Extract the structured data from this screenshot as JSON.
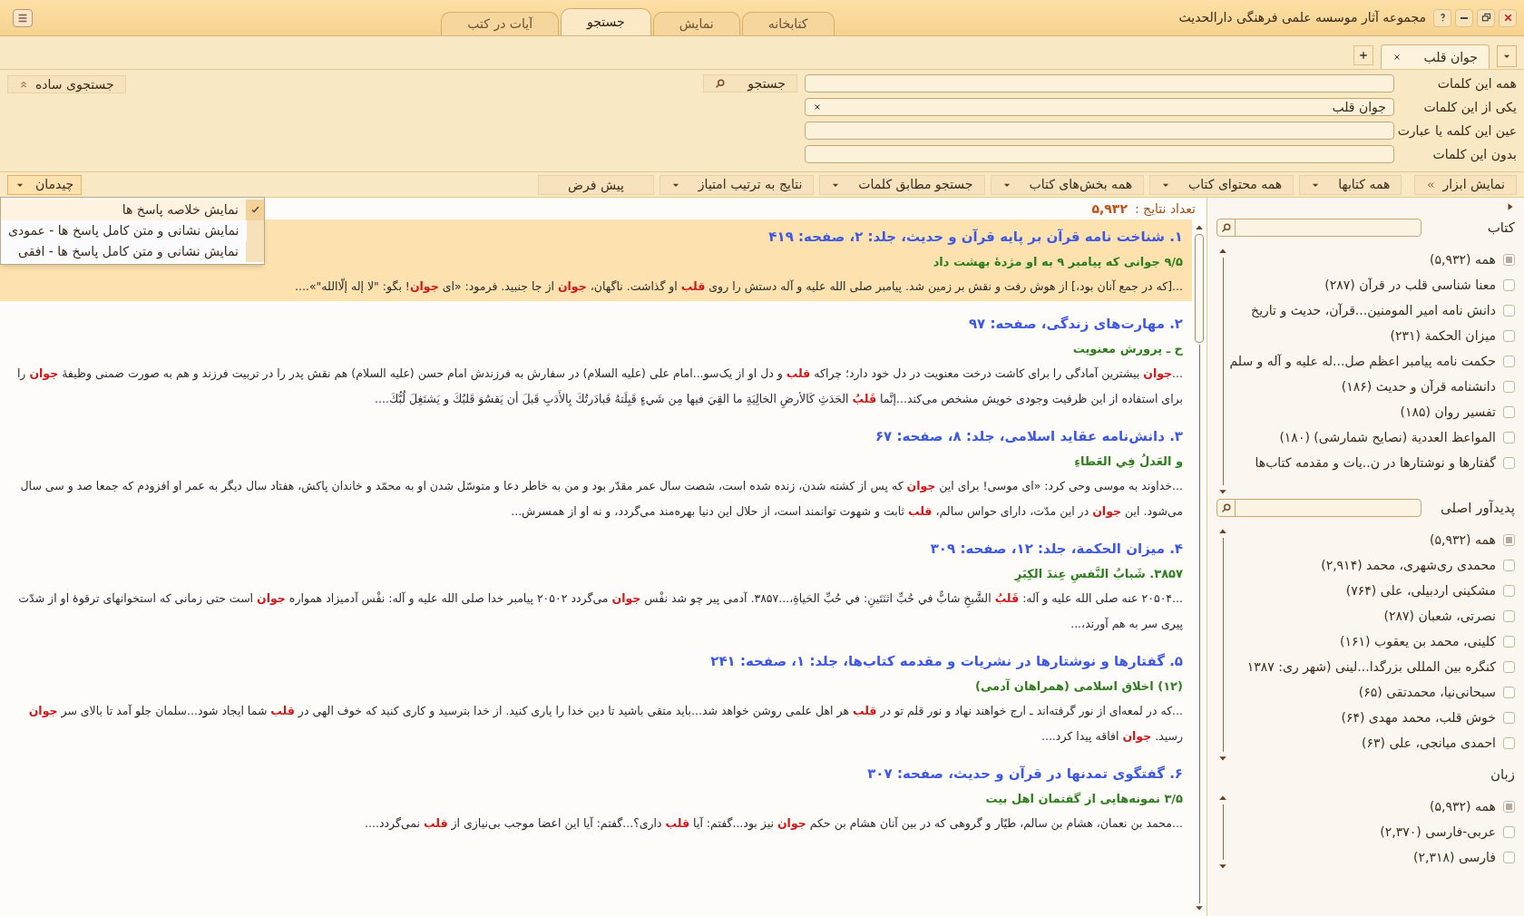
{
  "window": {
    "title": "مجموعه آثار موسسه علمی فرهنگی دارالحدیث"
  },
  "main_tabs": [
    {
      "label": "کتابخانه",
      "selected": false
    },
    {
      "label": "نمایش",
      "selected": false
    },
    {
      "label": "جستجو",
      "selected": true
    },
    {
      "label": "آیات در کتب",
      "selected": false
    }
  ],
  "search_tabs": [
    {
      "label": "جوان قلب",
      "selected": true
    }
  ],
  "search_form": {
    "rows": [
      {
        "label": "همه این کلمات",
        "value": ""
      },
      {
        "label": "یکی از این کلمات",
        "value": "جوان قلب"
      },
      {
        "label": "عین این کلمه یا عبارت",
        "value": ""
      },
      {
        "label": "بدون این کلمات",
        "value": ""
      }
    ],
    "search_button": "جستجو",
    "simple_search_button": "جستجوی ساده"
  },
  "toolbar": {
    "show_tools": "نمایش ابزار",
    "dropdowns": [
      {
        "label": "همه کتابها"
      },
      {
        "label": "همه محتوای کتاب"
      },
      {
        "label": "همه بخش‌های کتاب"
      },
      {
        "label": "جستجو مطابق کلمات"
      },
      {
        "label": "نتایج به ترتیب امتیاز"
      }
    ],
    "default_button": "پیش فرض",
    "layout_button": "چیدمان"
  },
  "layout_menu": {
    "expanded": true,
    "items": [
      {
        "label": "نمایش خلاصه پاسخ ها",
        "selected": true
      },
      {
        "label": "نمایش نشانی و متن کامل پاسخ ها - عمودی",
        "selected": false
      },
      {
        "label": "نمایش نشانی و متن کامل پاسخ ها - افقی",
        "selected": false
      }
    ]
  },
  "results": {
    "count_label": "تعداد نتایج :",
    "count": "۵,۹۳۲",
    "items": [
      {
        "selected": true,
        "title": "۱. شناخت نامه قرآن بر پایه قرآن و حدیث، جلد: ۲، صفحه: ۴۱۹",
        "subtitle": "۹/۵ جوانی که پیامبر ۹ به او مژدهٔ بهشت داد",
        "snippet": [
          {
            "text": "...[که در جمع آنان بود،] از هوش رفت و نقش بر زمین شد. پیامبر صلی الله علیه و آله دستش را روی ",
            "hit": false
          },
          {
            "text": "قلب",
            "hit": true
          },
          {
            "text": " او گذاشت. ناگهان، ",
            "hit": false
          },
          {
            "text": "جوان",
            "hit": true
          },
          {
            "text": " از جا جنبید. فرمود: «ای ",
            "hit": false
          },
          {
            "text": "جوان",
            "hit": true
          },
          {
            "text": "! بگو: \"لا إله إلّاالله\"»....",
            "hit": false
          }
        ]
      },
      {
        "selected": false,
        "title": "۲. مهارت‌های زندگی، صفحه: ۹۷",
        "subtitle": "ح ـ پرورش معنویت",
        "snippet": [
          {
            "text": "...",
            "hit": false
          },
          {
            "text": "جوان",
            "hit": true
          },
          {
            "text": " بیشترین آمادگی را برای کاشت درخت معنویت در دل خود دارد؛ چراکه ",
            "hit": false
          },
          {
            "text": "قلب",
            "hit": true
          },
          {
            "text": " و دل او از یک‌سو...امام علی (علیه السلام) در سفارش به فرزندش امام حسن (علیه السلام) هم نقش پدر را در تربیت فرزند و هم به صورت ضمنی وظیفهٔ ",
            "hit": false
          },
          {
            "text": "جوان",
            "hit": true
          },
          {
            "text": " را برای استفاده از این ظرفیت وجودی خویش مشخص می‌کند...إنَّما ",
            "hit": false
          },
          {
            "text": "قَلبُ",
            "hit": true
          },
          {
            "text": " الحَدَثِ كَالأرضِ الخالِيَةِ ما القِيَ فيها مِن شَيءٍ قَبِلَتهُ فَبادَرتُكَ بِالأَدَبِ قَبلَ أن يَقسُوَ قَلبُكَ و يَشتَغِلَ لُبُّكَ....",
            "hit": false
          }
        ]
      },
      {
        "selected": false,
        "title": "۳. دانش‌نامه عقاید اسلامی، جلد: ۸، صفحه: ۶۷",
        "subtitle": "و العَدلُ فِي العَطاءِ",
        "snippet": [
          {
            "text": "...خداوند به موسی وحی کرد: «ای موسی! برای این ",
            "hit": false
          },
          {
            "text": "جوان",
            "hit": true
          },
          {
            "text": " که پس از کشته شدن، زنده شده است، شصت سال عمر مقدّر بود و من به خاطر دعا و متوسّل شدن او به محمّد و خاندان پاکش، هفتاد سال دیگر به عمر او افزودم که جمعا صد و سی سال می‌شود. این ",
            "hit": false
          },
          {
            "text": "جوان",
            "hit": true
          },
          {
            "text": " در این مدّت، دارای حواس سالم، ",
            "hit": false
          },
          {
            "text": "قلب",
            "hit": true
          },
          {
            "text": " ثابت و شهوت توانمند است، از حلال این دنیا بهره‌مند می‌گردد، و نه او از همسرش...",
            "hit": false
          }
        ]
      },
      {
        "selected": false,
        "title": "۴. ميزان الحكمة، جلد: ۱۲، صفحه: ۳۰۹",
        "subtitle": "۳۸۵۷. شَبابُ النَّفسِ عِندَ الكِبَرِ",
        "snippet": [
          {
            "text": "...۲۰۵۰۴ عنه صلى الله عليه و آله: ",
            "hit": false
          },
          {
            "text": "قَلبُ",
            "hit": true
          },
          {
            "text": " الشَّيخِ شابٌّ في حُبِّ اثنَتَينِ: في حُبِّ الحَياةِ،...۳۸۵۷. آدمی پیر چو شد نفْس ",
            "hit": false
          },
          {
            "text": "جوان",
            "hit": true
          },
          {
            "text": " می‌گردد ۲۰۵۰۲ پیامبر خدا صلی الله علیه و آله: نفْس آدمیزاد همواره ",
            "hit": false
          },
          {
            "text": "جوان",
            "hit": true
          },
          {
            "text": " است حتی زمانی که استخوانهای ترقوهٔ او از شدّت پیری سر به هم آورند،...",
            "hit": false
          }
        ]
      },
      {
        "selected": false,
        "title": "۵. گفتارها و نوشتارها در نشریات و مقدمه کتاب‌ها، جلد: ۱، صفحه: ۲۴۱",
        "subtitle": "(۱۲) اخلاق اسلامی (همراهان آدمی)",
        "snippet": [
          {
            "text": "...که در لمعه‌ای از نور گرفته‌اند ـ ارج خواهند نهاد و نور قلم تو در ",
            "hit": false
          },
          {
            "text": "قلب",
            "hit": true
          },
          {
            "text": " هر اهل علمی روشن خواهد شد...باید متقی باشید تا دین خدا را یاری کنید. از خدا بترسید و کاری کنید که خوف الهی در ",
            "hit": false
          },
          {
            "text": "قلب",
            "hit": true
          },
          {
            "text": " شما ایجاد شود...سلمان جلو آمد تا بالای سر ",
            "hit": false
          },
          {
            "text": "جوان",
            "hit": true
          },
          {
            "text": " رسید. ",
            "hit": false
          },
          {
            "text": "جوان",
            "hit": true
          },
          {
            "text": " افاقه پیدا کرد....",
            "hit": false
          }
        ]
      },
      {
        "selected": false,
        "title": "۶. گفتگوی تمدنها در قرآن و حدیث، صفحه: ۳۰۷",
        "subtitle": "۳/۵ نمونه‌هایی از گفتمان اهل بیت",
        "snippet": [
          {
            "text": "...محمد بن نعمان، هشام بن سالم، طیّار و گروهی که در بین آنان هشام بن حکم ",
            "hit": false
          },
          {
            "text": "جوان",
            "hit": true
          },
          {
            "text": " نیز بود...گفتم: آیا ",
            "hit": false
          },
          {
            "text": "قلب",
            "hit": true
          },
          {
            "text": " داری؟...گفتم: آیا این اعضا موجب بی‌نیازی از ",
            "hit": false
          },
          {
            "text": "قلب",
            "hit": true
          },
          {
            "text": " نمی‌گردد....",
            "hit": false
          }
        ]
      }
    ]
  },
  "filters": [
    {
      "title": "کتاب",
      "has_search": true,
      "items": [
        {
          "label": "همه (۵,۹۳۲)",
          "checked": true
        },
        {
          "label": "معنا شناسی قلب در قرآن (۲۸۷)",
          "checked": false
        },
        {
          "label": "دانش نامه امیر المومنین...قرآن، حدیث و تاریخ",
          "checked": false
        },
        {
          "label": "ميزان الحكمة (۲۳۱)",
          "checked": false
        },
        {
          "label": "حکمت نامه پیامبر اعظم صل...له علیه و آله و سلم",
          "checked": false
        },
        {
          "label": "دانشنامه قرآن و حدیث (۱۸۶)",
          "checked": false
        },
        {
          "label": "تفسیر روان (۱۸۵)",
          "checked": false
        },
        {
          "label": "المواعظ العددية (نصایح شمارشی) (۱۸۰)",
          "checked": false
        },
        {
          "label": "گفتارها و نوشتارها در ن..یات و مقدمه کتاب‌ها",
          "checked": false
        }
      ]
    },
    {
      "title": "پدیدآور اصلی",
      "has_search": true,
      "items": [
        {
          "label": "همه (۵,۹۳۲)",
          "checked": true
        },
        {
          "label": "محمدی ری‌شهری، محمد (۲,۹۱۴)",
          "checked": false
        },
        {
          "label": "مشکینی اردبیلی، علی (۷۶۴)",
          "checked": false
        },
        {
          "label": "نصرتی، شعبان (۲۸۷)",
          "checked": false
        },
        {
          "label": "کلینی، محمد بن یعقوب (۱۶۱)",
          "checked": false
        },
        {
          "label": "کنگره بین المللی بزرگدا...لینی (شهر ری: ۱۳۸۷",
          "checked": false
        },
        {
          "label": "سبحانی‌نیا، محمدتقی (۶۵)",
          "checked": false
        },
        {
          "label": "خوش قلب، محمد مهدی (۶۴)",
          "checked": false
        },
        {
          "label": "احمدی میانجی، علی (۶۳)",
          "checked": false
        }
      ]
    },
    {
      "title": "زبان",
      "has_search": false,
      "items": [
        {
          "label": "همه (۵,۹۳۲)",
          "checked": true
        },
        {
          "label": "عربی-فارسی (۲,۳۷۰)",
          "checked": false
        },
        {
          "label": "فارسی (۲,۳۱۸)",
          "checked": false
        }
      ]
    }
  ]
}
